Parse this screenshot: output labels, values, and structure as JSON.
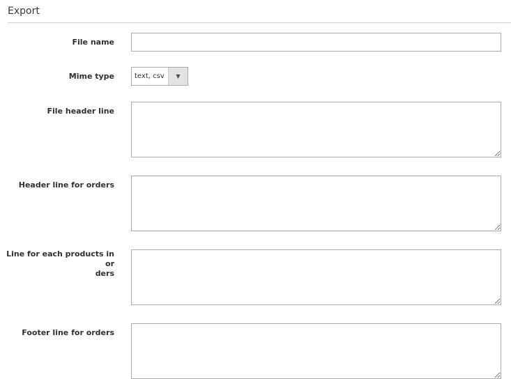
{
  "section": {
    "title": "Export"
  },
  "fields": {
    "file_name": {
      "label": "File name",
      "value": ""
    },
    "mime_type": {
      "label": "Mime type",
      "selected": "text, csv"
    },
    "file_header_line": {
      "label": "File header line",
      "value": ""
    },
    "header_line_orders": {
      "label": "Header line for orders",
      "value": ""
    },
    "line_each_product": {
      "label_line1": "Line for each products in or",
      "label_line2": "ders",
      "value": ""
    },
    "footer_line_orders": {
      "label": "Footer line for orders",
      "value": ""
    }
  },
  "icons": {
    "select_arrow": "chevron-down-icon"
  }
}
